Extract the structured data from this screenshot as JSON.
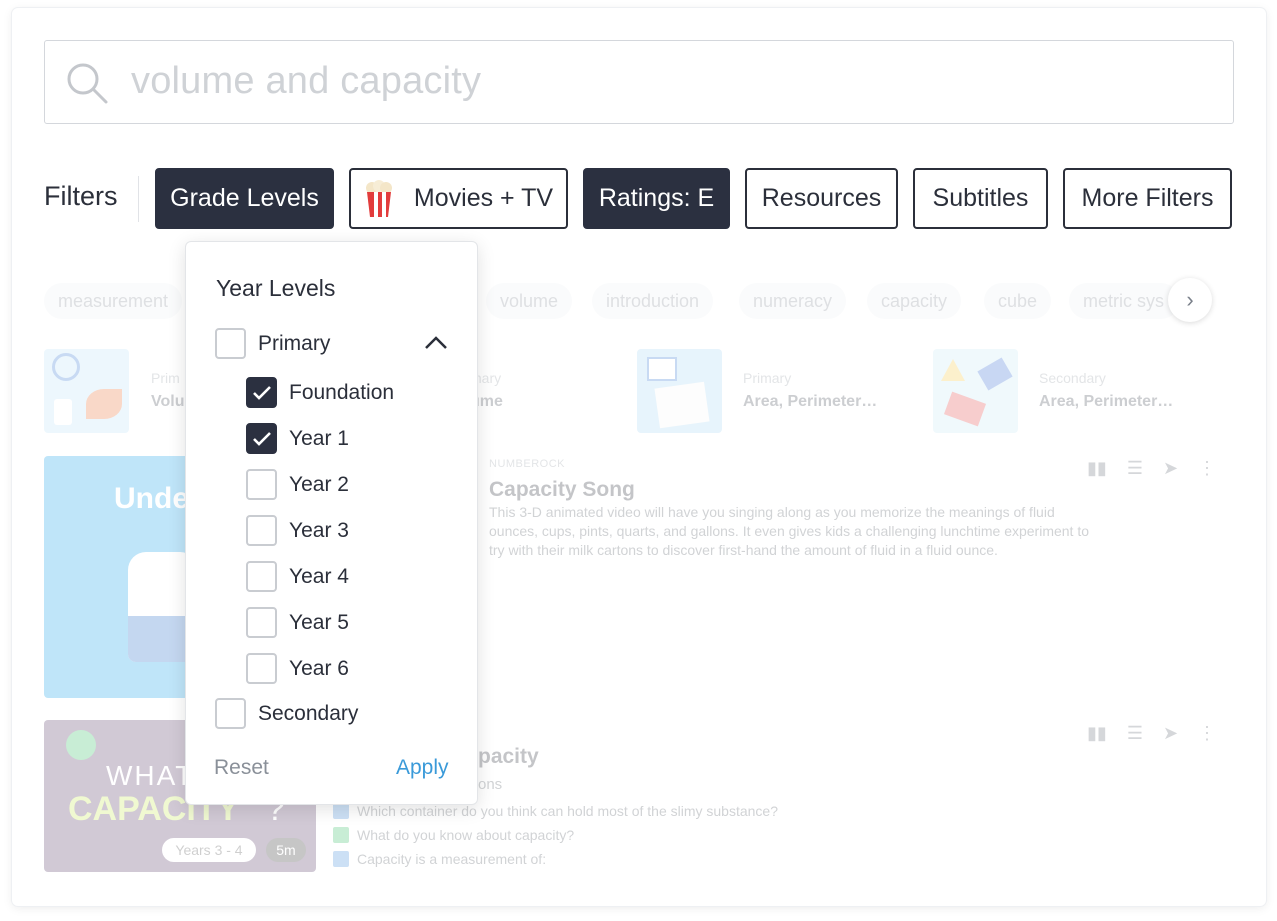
{
  "search": {
    "query": "volume and capacity"
  },
  "filters": {
    "label": "Filters",
    "buttons": {
      "grade_levels": "Grade Levels",
      "movies_tv": "Movies + TV",
      "ratings": "Ratings: E",
      "resources": "Resources",
      "subtitles": "Subtitles",
      "more_filters": "More Filters"
    }
  },
  "tags": [
    "measurement",
    "volume",
    "introduction",
    "numeracy",
    "capacity",
    "cube",
    "metric sys"
  ],
  "small_cards": [
    {
      "sub": "Prim",
      "title": "Volu"
    },
    {
      "sub": "mary",
      "title": "ume"
    },
    {
      "sub": "Primary",
      "title": "Area, Perimeter…"
    },
    {
      "sub": "Secondary",
      "title": "Area, Perimeter…"
    }
  ],
  "result1": {
    "provider": "NUMBEROCK",
    "title": "Capacity Song",
    "description": "This 3-D animated video will have you singing along as you memorize the meanings of fluid ounces, cups, pints, quarts, and gallons. It even gives kids a challenging lunchtime experiment to try with their milk cartons to discover first-hand the amount of fluid in a fluid ounce.",
    "thumb_text": "Under"
  },
  "result2": {
    "title_fragment": "pacity",
    "sub_fragment": "ons",
    "questions": [
      "Which container do you think can hold most of the slimy substance?",
      "What do you know about capacity?",
      "Capacity is a measurement of:"
    ],
    "thumb_line1": "WHAT",
    "thumb_line2": "CAPACITY",
    "thumb_q": "?",
    "years_pill": "Years 3 - 4",
    "duration_pill": "5m"
  },
  "dropdown": {
    "title": "Year Levels",
    "primary": "Primary",
    "items": [
      {
        "label": "Foundation",
        "checked": true
      },
      {
        "label": "Year 1",
        "checked": true
      },
      {
        "label": "Year 2",
        "checked": false
      },
      {
        "label": "Year 3",
        "checked": false
      },
      {
        "label": "Year 4",
        "checked": false
      },
      {
        "label": "Year 5",
        "checked": false
      },
      {
        "label": "Year 6",
        "checked": false
      }
    ],
    "secondary": "Secondary",
    "reset": "Reset",
    "apply": "Apply"
  },
  "colors": {
    "dark": "#2b3040",
    "apply": "#3a9ad9"
  }
}
